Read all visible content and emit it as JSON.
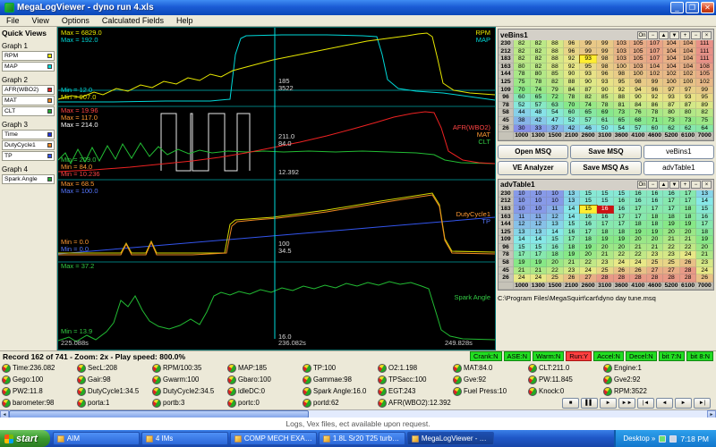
{
  "window": {
    "title": "MegaLogViewer - dyno run 4.xls",
    "menus": [
      "File",
      "View",
      "Options",
      "Calculated Fields",
      "Help"
    ]
  },
  "sidebar": {
    "header": "Quick Views",
    "groups": [
      {
        "label": "Graph 1",
        "items": [
          {
            "label": "RPM",
            "color": "#e8e800"
          },
          {
            "label": "MAP",
            "color": "#00e0e0"
          }
        ]
      },
      {
        "label": "Graph 2",
        "items": [
          {
            "label": "AFR(WBO2)",
            "color": "#ee2222"
          },
          {
            "label": "MAT",
            "color": "#ee8822"
          },
          {
            "label": "CLT",
            "color": "#22aa33"
          }
        ]
      },
      {
        "label": "Graph 3",
        "items": [
          {
            "label": "Time",
            "color": "#2233dd"
          },
          {
            "label": "DutyCycle1",
            "color": "#ee8822"
          },
          {
            "label": "TP",
            "color": "#3355ee"
          }
        ]
      },
      {
        "label": "Graph 4",
        "items": [
          {
            "label": "Spark Angle",
            "color": "#22aa33"
          }
        ]
      }
    ]
  },
  "graphs": {
    "panels": [
      {
        "max": [
          "Max = 6829.0",
          "Max = 192.0"
        ],
        "min": [
          "Min = 12.0",
          "Min = 907.0"
        ],
        "series": [
          "RPM",
          "MAP"
        ],
        "cursor": [
          "185",
          "3522"
        ]
      },
      {
        "max": [
          "Max = 19.96",
          "Max = 117.0",
          "Max = 214.0"
        ],
        "min": [
          "Min = 209.0",
          "Min = 84.0",
          "Min = 10.236"
        ],
        "series": [
          "AFR(WBO2)",
          "MAT",
          "CLT"
        ],
        "cursor": [
          "211.0",
          "84.0",
          "12.392"
        ]
      },
      {
        "max": [
          "Max = 68.5",
          "Max = 100.0"
        ],
        "min": [
          "Min = 0.0",
          "Min = 0.0"
        ],
        "series": [
          "DutyCycle1",
          "TP"
        ],
        "cursor": [
          "100",
          "34.5"
        ]
      },
      {
        "max": [
          "Max = 37.2"
        ],
        "min": [
          "Min = 13.9"
        ],
        "series": [
          "Spark Angle"
        ],
        "cursor": [
          "16.0"
        ]
      }
    ],
    "time_axis": [
      "225.088s",
      "236.082s",
      "249.828s"
    ]
  },
  "right_panel": {
    "ve_table": {
      "title": "veBins1",
      "toolbar": [
        "On",
        "−",
        "▲",
        "▼",
        "+",
        "−",
        "×"
      ],
      "col_headers": [
        "1000",
        "1300",
        "1500",
        "2100",
        "2600",
        "3100",
        "3600",
        "4100",
        "4600",
        "5200",
        "6100",
        "7000"
      ],
      "row_headers": [
        "230",
        "212",
        "183",
        "163",
        "144",
        "125",
        "109",
        "96",
        "78",
        "58",
        "45",
        "26"
      ],
      "rows": [
        [
          82,
          82,
          88,
          96,
          99,
          99,
          103,
          105,
          107,
          104,
          104,
          111
        ],
        [
          82,
          82,
          88,
          96,
          99,
          99,
          103,
          105,
          107,
          104,
          104,
          111
        ],
        [
          82,
          82,
          88,
          92,
          93,
          98,
          103,
          105,
          107,
          104,
          104,
          111
        ],
        [
          80,
          82,
          88,
          92,
          95,
          98,
          100,
          103,
          104,
          104,
          104,
          108
        ],
        [
          78,
          80,
          85,
          90,
          93,
          96,
          98,
          100,
          102,
          102,
          102,
          105
        ],
        [
          75,
          78,
          82,
          88,
          90,
          93,
          95,
          98,
          99,
          100,
          100,
          102
        ],
        [
          70,
          74,
          79,
          84,
          87,
          90,
          92,
          94,
          96,
          97,
          97,
          99
        ],
        [
          60,
          65,
          72,
          78,
          82,
          85,
          88,
          90,
          92,
          93,
          93,
          95
        ],
        [
          52,
          57,
          63,
          70,
          74,
          78,
          81,
          84,
          86,
          87,
          87,
          89
        ],
        [
          44,
          48,
          54,
          60,
          65,
          69,
          73,
          76,
          78,
          80,
          80,
          82
        ],
        [
          38,
          42,
          47,
          52,
          57,
          61,
          65,
          68,
          71,
          73,
          73,
          75
        ],
        [
          30,
          33,
          37,
          42,
          46,
          50,
          54,
          57,
          60,
          62,
          62,
          64
        ]
      ],
      "selected": {
        "row": 2,
        "col": 4
      }
    },
    "buttons": [
      [
        "Open MSQ",
        "Save MSQ",
        "veBins1"
      ],
      [
        "VE Analyzer",
        "Save MSQ As",
        "advTable1"
      ]
    ],
    "adv_table": {
      "title": "advTable1",
      "toolbar": [
        "On",
        "−",
        "▲",
        "▼",
        "+",
        "−",
        "×"
      ],
      "col_headers": [
        "1000",
        "1300",
        "1500",
        "2100",
        "2600",
        "3100",
        "3600",
        "4100",
        "4600",
        "5200",
        "6100",
        "7000"
      ],
      "row_headers": [
        "230",
        "212",
        "183",
        "163",
        "144",
        "125",
        "109",
        "96",
        "78",
        "58",
        "45",
        "26"
      ],
      "rows": [
        [
          10,
          10,
          10,
          13,
          15,
          15,
          15,
          16,
          16,
          16,
          17,
          13
        ],
        [
          10,
          10,
          10,
          13,
          15,
          15,
          16,
          16,
          16,
          17,
          17,
          14
        ],
        [
          10,
          10,
          11,
          14,
          15,
          16,
          16,
          17,
          17,
          17,
          18,
          15
        ],
        [
          11,
          11,
          12,
          14,
          16,
          16,
          17,
          17,
          18,
          18,
          18,
          16
        ],
        [
          12,
          12,
          13,
          15,
          16,
          17,
          17,
          18,
          18,
          19,
          19,
          17
        ],
        [
          13,
          13,
          14,
          16,
          17,
          18,
          18,
          19,
          19,
          20,
          20,
          18
        ],
        [
          14,
          14,
          15,
          17,
          18,
          19,
          19,
          20,
          20,
          21,
          21,
          19
        ],
        [
          15,
          15,
          16,
          18,
          19,
          20,
          20,
          21,
          21,
          22,
          22,
          20
        ],
        [
          17,
          17,
          18,
          19,
          20,
          21,
          22,
          22,
          23,
          23,
          24,
          21
        ],
        [
          19,
          19,
          20,
          21,
          22,
          23,
          24,
          24,
          25,
          25,
          26,
          23
        ],
        [
          21,
          21,
          22,
          23,
          24,
          25,
          26,
          26,
          27,
          27,
          28,
          24
        ],
        [
          24,
          24,
          25,
          26,
          27,
          28,
          28,
          28,
          28,
          28,
          28,
          26
        ]
      ],
      "selected": {
        "row": 2,
        "col": 4
      },
      "active": {
        "row": 2,
        "col": 5
      }
    },
    "file_path": "C:\\Program Files\\MegaSquirt\\cart\\dyno day tune.msq"
  },
  "status": {
    "text": "Record 162 of 741 - Zoom: 2x - Play speed: 800.0%"
  },
  "indicators": [
    {
      "label": "Crank:N"
    },
    {
      "label": "ASE:N"
    },
    {
      "label": "Warm:N"
    },
    {
      "label": "Run:Y",
      "alert": true
    },
    {
      "label": "Accel:N"
    },
    {
      "label": "Decel:N"
    },
    {
      "label": "bit 7:N"
    },
    {
      "label": "bit 8:N"
    }
  ],
  "gauges": {
    "rows": [
      [
        {
          "label": "Time",
          "value": "236.082"
        },
        {
          "label": "SecL",
          "value": "208"
        },
        {
          "label": "RPM/100",
          "value": "35"
        },
        {
          "label": "MAP",
          "value": "185"
        },
        {
          "label": "TP",
          "value": "100"
        },
        {
          "label": "O2",
          "value": "1.198"
        },
        {
          "label": "MAT",
          "value": "84.0"
        },
        {
          "label": "CLT",
          "value": "211.0"
        },
        {
          "label": "Engine",
          "value": "1"
        }
      ],
      [
        {
          "label": "Gego",
          "value": "100"
        },
        {
          "label": "Gair",
          "value": "98"
        },
        {
          "label": "Gwarm",
          "value": "100"
        },
        {
          "label": "Gbaro",
          "value": "100"
        },
        {
          "label": "Gammae",
          "value": "98"
        },
        {
          "label": "TPSacc",
          "value": "100"
        },
        {
          "label": "Gve",
          "value": "92"
        },
        {
          "label": "PW",
          "value": "11.845"
        },
        {
          "label": "Gve2",
          "value": "92"
        }
      ],
      [
        {
          "label": "PW2",
          "value": "11.8"
        },
        {
          "label": "DutyCycle1",
          "value": "34.5"
        },
        {
          "label": "DutyCycle2",
          "value": "34.5"
        },
        {
          "label": "idleDC",
          "value": "0"
        },
        {
          "label": "Spark Angle",
          "value": "16.0"
        },
        {
          "label": "EGT",
          "value": "243"
        },
        {
          "label": "Fuel Press",
          "value": "10"
        },
        {
          "label": "Knock",
          "value": "0"
        },
        {
          "label": "RPM",
          "value": "3522"
        }
      ],
      [
        {
          "label": "barometer",
          "value": "98"
        },
        {
          "label": "porta",
          "value": "1"
        },
        {
          "label": "portb",
          "value": "3"
        },
        {
          "label": "portc",
          "value": "0"
        },
        {
          "label": "portd",
          "value": "62"
        },
        {
          "label": "AFR(WBO2)",
          "value": "12.392"
        }
      ]
    ]
  },
  "media_controls": [
    {
      "name": "stop",
      "glyph": "■"
    },
    {
      "name": "pause",
      "glyph": "▌▌"
    },
    {
      "name": "play",
      "glyph": "►"
    },
    {
      "name": "fast-forward",
      "glyph": "►►"
    },
    {
      "name": "skip-start",
      "glyph": "|◄"
    },
    {
      "name": "step-back",
      "glyph": "◄"
    },
    {
      "name": "step-forward",
      "glyph": "►"
    },
    {
      "name": "skip-end",
      "glyph": "►|"
    }
  ],
  "note": {
    "text": "Logs, Vex files, ect available upon request."
  },
  "taskbar": {
    "start": "start",
    "buttons": [
      {
        "label": "AIM"
      },
      {
        "label": "4 IMs"
      },
      {
        "label": "COMP MECH EXAM -..."
      },
      {
        "label": "1.8L Sr20 T25 turbo..."
      },
      {
        "label": "MegaLogViewer - dyn...",
        "active": true
      }
    ],
    "tray_label": "Desktop",
    "clock": "7:18 PM"
  }
}
